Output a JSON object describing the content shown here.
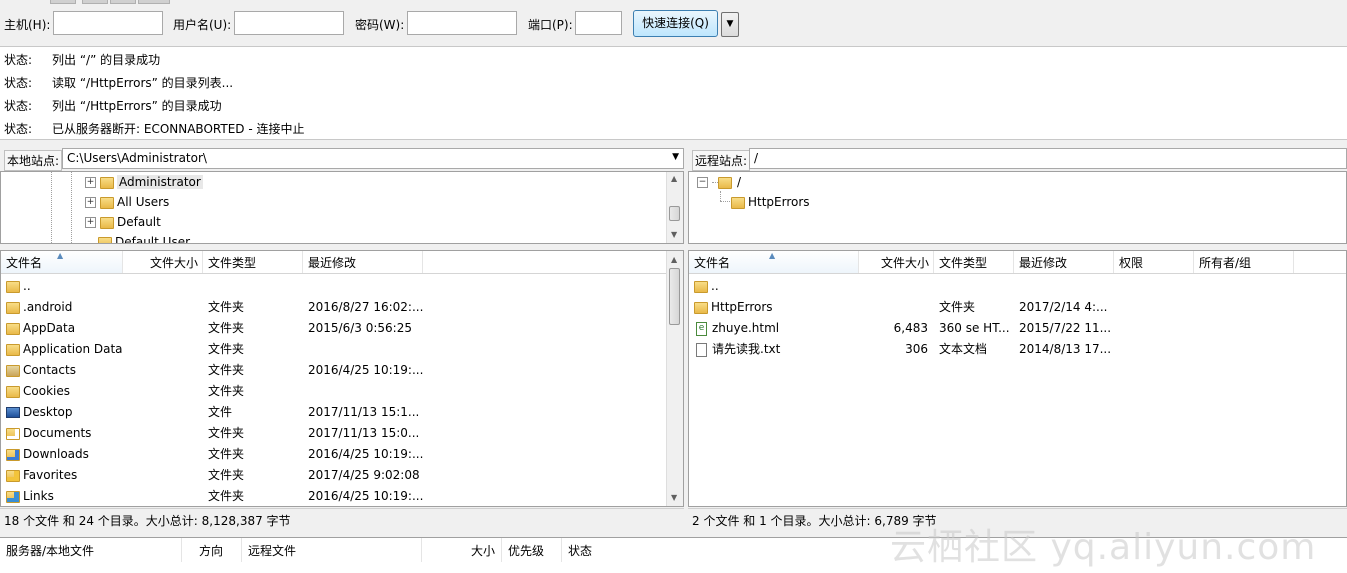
{
  "quickconnect": {
    "host_label": "主机(H):",
    "user_label": "用户名(U):",
    "pass_label": "密码(W):",
    "port_label": "端口(P):",
    "host_value": "",
    "user_value": "",
    "pass_value": "",
    "port_value": "",
    "connect_label": "快速连接(Q)",
    "dropdown_glyph": "▼"
  },
  "log": [
    {
      "label": "状态:",
      "text": "列出 “/” 的目录成功"
    },
    {
      "label": "状态:",
      "text": "读取 “/HttpErrors” 的目录列表..."
    },
    {
      "label": "状态:",
      "text": "列出 “/HttpErrors” 的目录成功"
    },
    {
      "label": "状态:",
      "text": "已从服务器断开: ECONNABORTED - 连接中止"
    }
  ],
  "local": {
    "site_label": "本地站点:",
    "site_path": "C:\\Users\\Administrator\\",
    "tree": [
      {
        "name": "Administrator",
        "expander": "+"
      },
      {
        "name": "All Users",
        "expander": "+"
      },
      {
        "name": "Default",
        "expander": "+"
      },
      {
        "name": "Default User",
        "expander": ""
      }
    ],
    "columns": [
      "文件名",
      "文件大小",
      "文件类型",
      "最近修改"
    ],
    "files": [
      {
        "name": "..",
        "size": "",
        "type": "",
        "modified": "",
        "icon": "folder-icon"
      },
      {
        "name": ".android",
        "size": "",
        "type": "文件夹",
        "modified": "2016/8/27 16:02:...",
        "icon": "folder-icon"
      },
      {
        "name": "AppData",
        "size": "",
        "type": "文件夹",
        "modified": "2015/6/3 0:56:25",
        "icon": "folder-icon"
      },
      {
        "name": "Application Data",
        "size": "",
        "type": "文件夹",
        "modified": "",
        "icon": "folder-icon"
      },
      {
        "name": "Contacts",
        "size": "",
        "type": "文件夹",
        "modified": "2016/4/25 10:19:...",
        "icon": "contacts-folder-icon"
      },
      {
        "name": "Cookies",
        "size": "",
        "type": "文件夹",
        "modified": "",
        "icon": "folder-icon"
      },
      {
        "name": "Desktop",
        "size": "",
        "type": "文件",
        "modified": "2017/11/13 15:1...",
        "icon": "desktop-icon"
      },
      {
        "name": "Documents",
        "size": "",
        "type": "文件夹",
        "modified": "2017/11/13 15:0...",
        "icon": "documents-folder-icon"
      },
      {
        "name": "Downloads",
        "size": "",
        "type": "文件夹",
        "modified": "2016/4/25 10:19:...",
        "icon": "downloads-folder-icon"
      },
      {
        "name": "Favorites",
        "size": "",
        "type": "文件夹",
        "modified": "2017/4/25 9:02:08",
        "icon": "favorites-folder-icon"
      },
      {
        "name": "Links",
        "size": "",
        "type": "文件夹",
        "modified": "2016/4/25 10:19:...",
        "icon": "links-folder-icon"
      }
    ],
    "status": "18 个文件 和 24 个目录。大小总计: 8,128,387 字节"
  },
  "remote": {
    "site_label": "远程站点:",
    "site_path": "/",
    "tree": [
      {
        "name": "/",
        "expander": "−"
      },
      {
        "name": "HttpErrors",
        "expander": ""
      }
    ],
    "columns": [
      "文件名",
      "文件大小",
      "文件类型",
      "最近修改",
      "权限",
      "所有者/组"
    ],
    "files": [
      {
        "name": "..",
        "size": "",
        "type": "",
        "modified": "",
        "icon": "folder-icon"
      },
      {
        "name": "HttpErrors",
        "size": "",
        "type": "文件夹",
        "modified": "2017/2/14 4:...",
        "icon": "folder-icon"
      },
      {
        "name": "zhuye.html",
        "size": "6,483",
        "type": "360 se HT...",
        "modified": "2015/7/22 11...",
        "icon": "html-file-icon"
      },
      {
        "name": "请先读我.txt",
        "size": "306",
        "type": "文本文档",
        "modified": "2014/8/13 17...",
        "icon": "text-file-icon"
      }
    ],
    "status": "2 个文件 和 1 个目录。大小总计: 6,789 字节"
  },
  "queue": {
    "columns": [
      "服务器/本地文件",
      "方向",
      "远程文件",
      "大小",
      "优先级",
      "状态"
    ]
  },
  "watermark": "云栖社区 yq.aliyun.com",
  "colors": {
    "accent": "#3c7fb1",
    "folder": "#e9b949"
  }
}
